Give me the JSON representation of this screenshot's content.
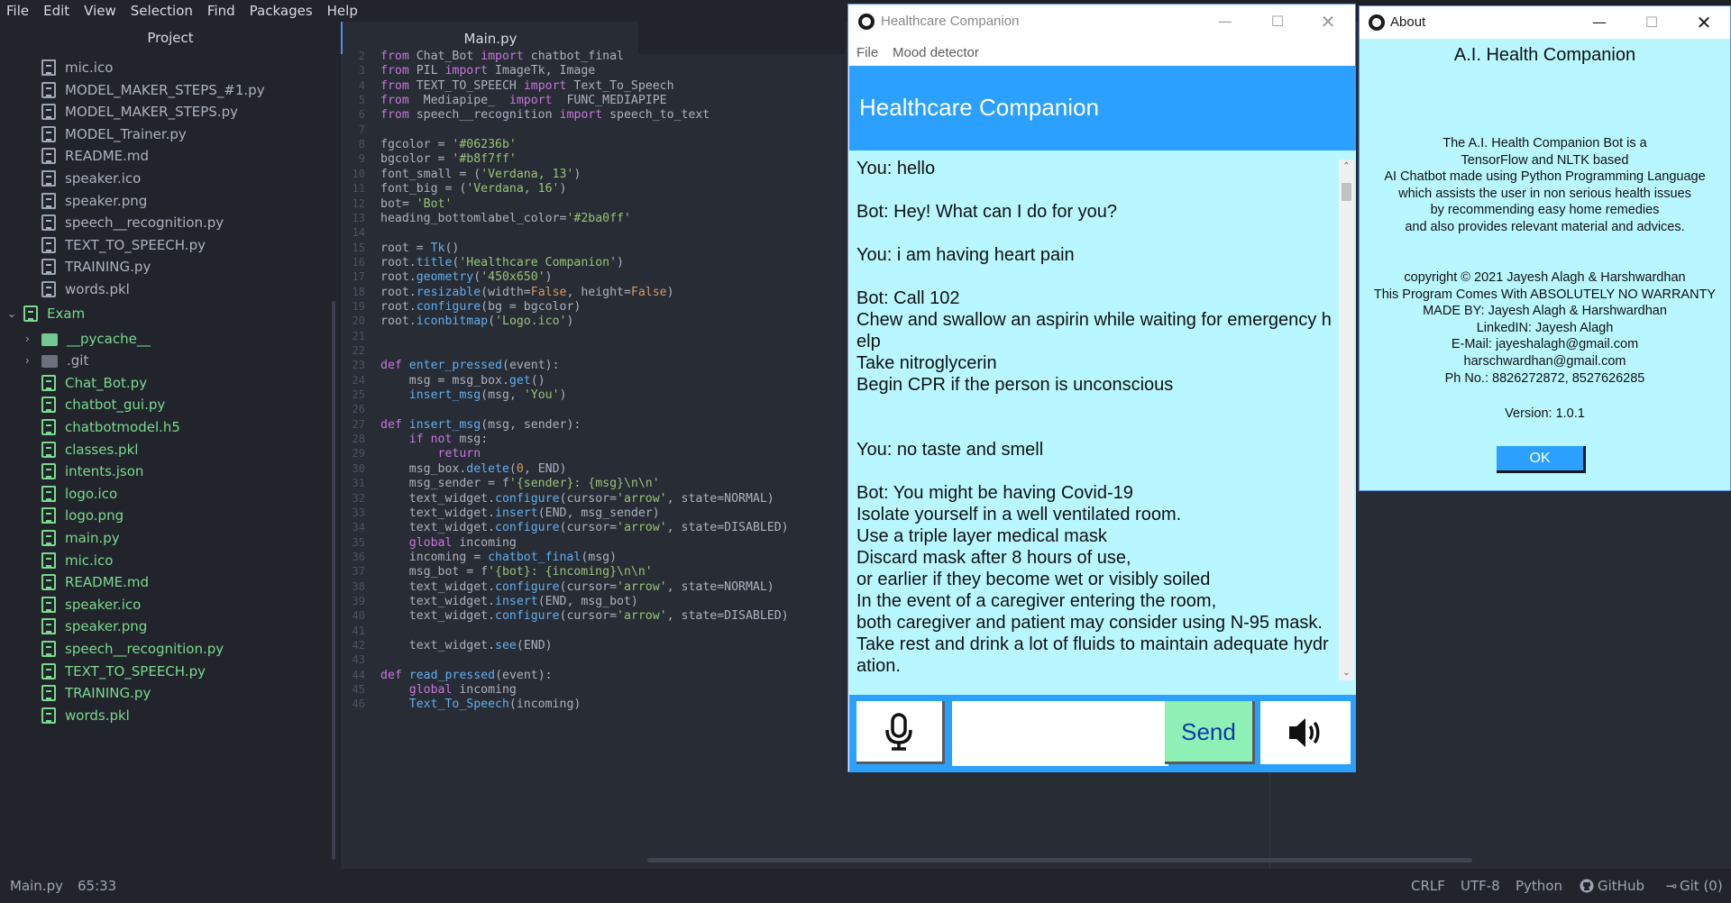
{
  "menu": [
    "File",
    "Edit",
    "View",
    "Selection",
    "Find",
    "Packages",
    "Help"
  ],
  "project": {
    "title": "Project",
    "files_top": [
      {
        "name": "mic.ico",
        "icon": "image"
      },
      {
        "name": "MODEL_MAKER_STEPS_#1.py",
        "icon": "file"
      },
      {
        "name": "MODEL_MAKER_STEPS.py",
        "icon": "file"
      },
      {
        "name": "MODEL_Trainer.py",
        "icon": "file"
      },
      {
        "name": "README.md",
        "icon": "book"
      },
      {
        "name": "speaker.ico",
        "icon": "image"
      },
      {
        "name": "speaker.png",
        "icon": "image"
      },
      {
        "name": "speech__recognition.py",
        "icon": "file"
      },
      {
        "name": "TEXT_TO_SPEECH.py",
        "icon": "file"
      },
      {
        "name": "TRAINING.py",
        "icon": "file"
      },
      {
        "name": "words.pkl",
        "icon": "file"
      }
    ],
    "exam_folder": "Exam",
    "subfolders": [
      "__pycache__",
      ".git"
    ],
    "files_exam": [
      {
        "name": "Chat_Bot.py",
        "icon": "file"
      },
      {
        "name": "chatbot_gui.py",
        "icon": "file"
      },
      {
        "name": "chatbotmodel.h5",
        "icon": "file"
      },
      {
        "name": "classes.pkl",
        "icon": "file"
      },
      {
        "name": "intents.json",
        "icon": "file"
      },
      {
        "name": "logo.ico",
        "icon": "image"
      },
      {
        "name": "logo.png",
        "icon": "image"
      },
      {
        "name": "main.py",
        "icon": "file"
      },
      {
        "name": "mic.ico",
        "icon": "image"
      },
      {
        "name": "README.md",
        "icon": "book"
      },
      {
        "name": "speaker.ico",
        "icon": "image"
      },
      {
        "name": "speaker.png",
        "icon": "image"
      },
      {
        "name": "speech__recognition.py",
        "icon": "file"
      },
      {
        "name": "TEXT_TO_SPEECH.py",
        "icon": "file"
      },
      {
        "name": "TRAINING.py",
        "icon": "file"
      },
      {
        "name": "words.pkl",
        "icon": "file"
      }
    ]
  },
  "editor": {
    "tab": "Main.py",
    "lines": [
      [
        2,
        "from Chat_Bot import chatbot_final"
      ],
      [
        3,
        "from PIL import ImageTk, Image"
      ],
      [
        4,
        "from TEXT_TO_SPEECH import Text_To_Speech"
      ],
      [
        5,
        "from  Mediapipe_  import  FUNC_MEDIAPIPE"
      ],
      [
        6,
        "from speech__recognition import speech_to_text"
      ],
      [
        7,
        ""
      ],
      [
        8,
        "fgcolor = '#06236b'"
      ],
      [
        9,
        "bgcolor = '#b8f7ff'"
      ],
      [
        10,
        "font_small = ('Verdana, 13')"
      ],
      [
        11,
        "font_big = ('Verdana, 16')"
      ],
      [
        12,
        "bot= 'Bot'"
      ],
      [
        13,
        "heading_bottomlabel_color='#2ba0ff'"
      ],
      [
        14,
        ""
      ],
      [
        15,
        "root = Tk()"
      ],
      [
        16,
        "root.title('Healthcare Companion')"
      ],
      [
        17,
        "root.geometry('450x650')"
      ],
      [
        18,
        "root.resizable(width=False, height=False)"
      ],
      [
        19,
        "root.configure(bg = bgcolor)"
      ],
      [
        20,
        "root.iconbitmap('Logo.ico')"
      ],
      [
        21,
        ""
      ],
      [
        22,
        ""
      ],
      [
        23,
        "def enter_pressed(event):"
      ],
      [
        24,
        "    msg = msg_box.get()"
      ],
      [
        25,
        "    insert_msg(msg, 'You')"
      ],
      [
        26,
        ""
      ],
      [
        27,
        "def insert_msg(msg, sender):"
      ],
      [
        28,
        "    if not msg:"
      ],
      [
        29,
        "        return"
      ],
      [
        30,
        "    msg_box.delete(0, END)"
      ],
      [
        31,
        "    msg_sender = f'{sender}: {msg}\\n\\n'"
      ],
      [
        32,
        "    text_widget.configure(cursor='arrow', state=NORMAL)"
      ],
      [
        33,
        "    text_widget.insert(END, msg_sender)"
      ],
      [
        34,
        "    text_widget.configure(cursor='arrow', state=DISABLED)"
      ],
      [
        35,
        "    global incoming"
      ],
      [
        36,
        "    incoming = chatbot_final(msg)"
      ],
      [
        37,
        "    msg_bot = f'{bot}: {incoming}\\n\\n'"
      ],
      [
        38,
        "    text_widget.configure(cursor='arrow', state=NORMAL)"
      ],
      [
        39,
        "    text_widget.insert(END, msg_bot)"
      ],
      [
        40,
        "    text_widget.configure(cursor='arrow', state=DISABLED)"
      ],
      [
        41,
        ""
      ],
      [
        42,
        "    text_widget.see(END)"
      ],
      [
        43,
        ""
      ],
      [
        44,
        "def read_pressed(event):"
      ],
      [
        45,
        "    global incoming"
      ],
      [
        46,
        "    Text_To_Speech(incoming)"
      ]
    ]
  },
  "status": {
    "file": "Main.py",
    "cursor": "65:33",
    "line_ending": "CRLF",
    "encoding": "UTF-8",
    "grammar": "Python",
    "github": "GitHub",
    "git": "Git (0)"
  },
  "healthcare": {
    "window_title": "Healthcare Companion",
    "menu_file": "File",
    "menu_mood": "Mood detector",
    "header": "Healthcare Companion",
    "chat": "You: hello\n\nBot: Hey! What can I do for you?\n\nYou: i am having heart pain\n\nBot: Call 102\nChew and swallow an aspirin while waiting for emergency h\nelp\nTake nitroglycerin\nBegin CPR if the person is unconscious\n\n\nYou: no taste and smell\n\nBot: You might be having Covid-19\nIsolate yourself in a well ventilated room.\nUse a triple layer medical mask\nDiscard mask after 8 hours of use,\nor earlier if they become wet or visibly soiled\nIn the event of a caregiver entering the room,\nboth caregiver and patient may consider using N-95 mask.\nTake rest and drink a lot of fluids to maintain adequate hydr\nation.",
    "send_label": "Send",
    "input_value": "",
    "colors": {
      "header": "#2ba0ff",
      "chat_bg": "#b8f7ff",
      "send_bg": "#8ef0b5",
      "send_text": "#0d3aa9"
    }
  },
  "about": {
    "window_title": "About",
    "heading": "A.I. Health Companion",
    "description": "The A.I. Health Companion Bot is a\nTensorFlow and NLTK based\nAI Chatbot made using Python Programming Language\nwhich assists the user in non serious health issues\nby recommending easy home remedies\nand also provides relevant material and advices.",
    "credits": "copyright © 2021 Jayesh Alagh & Harshwardhan\nThis Program Comes With ABSOLUTELY NO WARRANTY\nMADE BY: Jayesh Alagh & Harshwardhan\nLinkedIN: Jayesh Alagh\nE-Mail: jayeshalagh@gmail.com\nharschwardhan@gmail.com\nPh No.: 8826272872, 8527626285",
    "version": "Version: 1.0.1",
    "ok_label": "OK"
  }
}
